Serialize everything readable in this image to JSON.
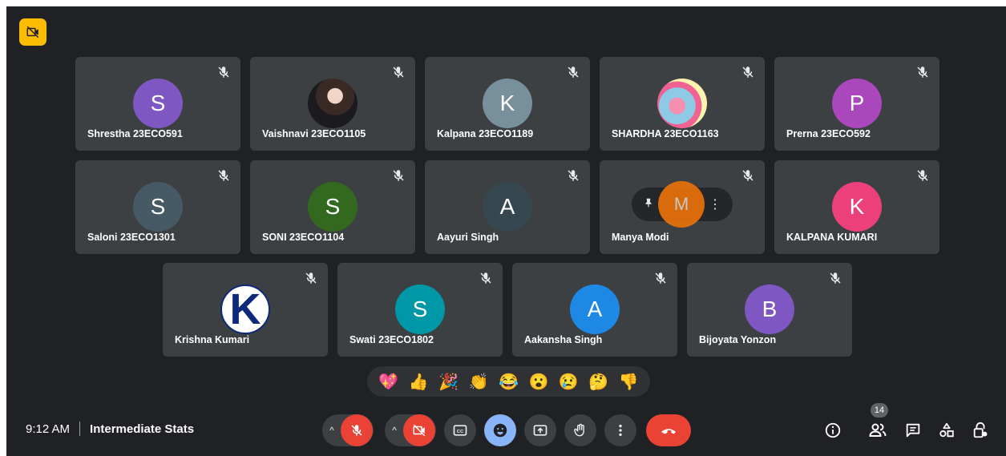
{
  "meeting": {
    "time": "9:12 AM",
    "title": "Intermediate Stats"
  },
  "participants": [
    {
      "name": "Shrestha 23ECO591",
      "initial": "S",
      "color": "#7e57c2",
      "muted": true
    },
    {
      "name": "Vaishnavi 23ECO1105",
      "initial": "",
      "color": "#1b1b1f",
      "muted": true,
      "photo": true
    },
    {
      "name": "Kalpana 23ECO1189",
      "initial": "K",
      "color": "#78909c",
      "muted": true
    },
    {
      "name": "SHARDHA 23ECO1163",
      "initial": "",
      "color": "#f48fb1",
      "muted": true,
      "photo": true
    },
    {
      "name": "Prerna 23ECO592",
      "initial": "P",
      "color": "#ab47bc",
      "muted": true
    },
    {
      "name": "Saloni 23ECO1301",
      "initial": "S",
      "color": "#455a64",
      "muted": true
    },
    {
      "name": "SONI 23ECO1104",
      "initial": "S",
      "color": "#33691e",
      "muted": true
    },
    {
      "name": "Aayuri Singh",
      "initial": "A",
      "color": "#37474f",
      "muted": true
    },
    {
      "name": "Manya Modi",
      "initial": "M",
      "color": "#ef6c00",
      "muted": true,
      "hovered": true
    },
    {
      "name": "KALPANA KUMARI",
      "initial": "K",
      "color": "#ec407a",
      "muted": true
    },
    {
      "name": "Krishna Kumari",
      "initial": "K",
      "color": "#ffffff",
      "muted": true,
      "logo": true
    },
    {
      "name": "Swati 23ECO1802",
      "initial": "S",
      "color": "#0097a7",
      "muted": true
    },
    {
      "name": "Aakansha Singh",
      "initial": "A",
      "color": "#1e88e5",
      "muted": true
    },
    {
      "name": "Bijoyata Yonzon",
      "initial": "B",
      "color": "#7e57c2",
      "muted": true
    }
  ],
  "reactions": [
    "💖",
    "👍",
    "🎉",
    "👏",
    "😂",
    "😮",
    "😢",
    "🤔",
    "👎"
  ],
  "people_count": "14",
  "controls": {
    "mic_state": "off",
    "camera_state": "off"
  },
  "icons": {
    "camera_off_badge": "camera-off-icon",
    "muted": "mic-off-icon",
    "pin": "pin-icon",
    "more": "more-vert-icon"
  }
}
